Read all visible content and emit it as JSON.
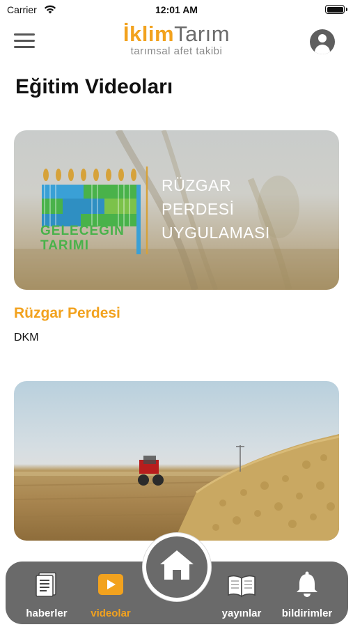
{
  "status_bar": {
    "carrier": "Carrier",
    "time": "12:01 AM"
  },
  "header": {
    "logo_part1": "İklim",
    "logo_part2": "Tarım",
    "logo_subtitle": "tarımsal afet takibi"
  },
  "page_title": "Eğitim Videoları",
  "videos": [
    {
      "title": "Rüzgar Perdesi",
      "source": "DKM",
      "thumbnail": {
        "brand_line1": "GELECEĞİN",
        "brand_line2": "TARIMI",
        "caption_line1": "RÜZGAR",
        "caption_line2": "PERDESİ",
        "caption_line3": "UYGULAMASI"
      }
    },
    {
      "title": "",
      "source": "",
      "thumbnail": {}
    }
  ],
  "bottom_nav": {
    "items": [
      {
        "label": "haberler",
        "icon": "newspaper-icon",
        "active": false
      },
      {
        "label": "videolar",
        "icon": "video-play-icon",
        "active": true
      },
      {
        "label": "yayınlar",
        "icon": "book-icon",
        "active": false
      },
      {
        "label": "bildirimler",
        "icon": "bell-icon",
        "active": false
      }
    ],
    "home_icon": "home-icon"
  },
  "colors": {
    "accent": "#f2a21e",
    "nav_background": "#6a6a6a",
    "text": "#111111"
  }
}
